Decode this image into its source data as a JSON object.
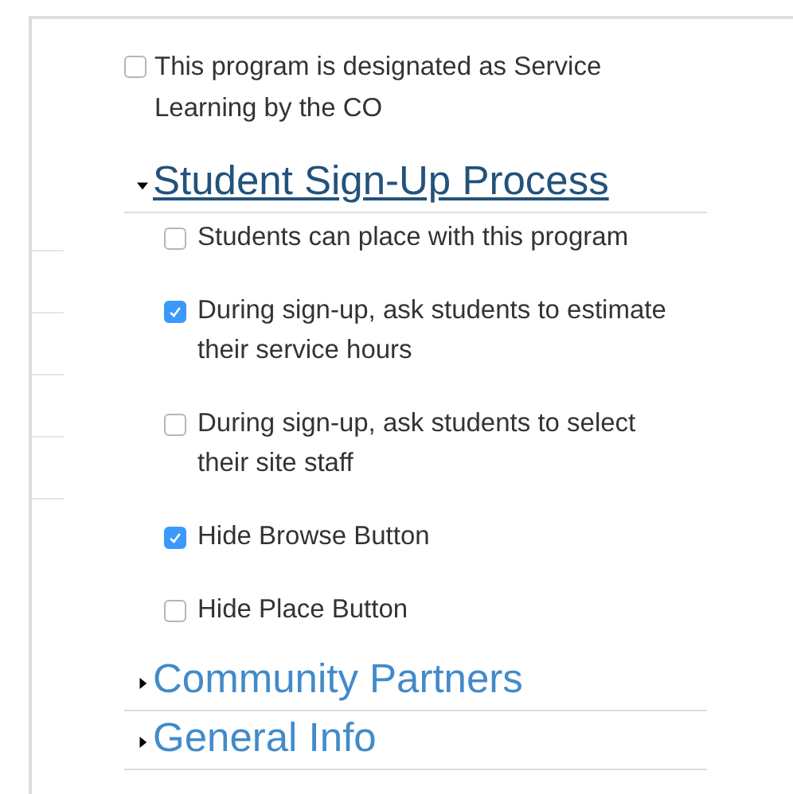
{
  "designation": {
    "label": "This program is designated as Service Learning by the CO",
    "checked": false
  },
  "sections": [
    {
      "title": "Student Sign-Up Process",
      "expanded": true,
      "options": [
        {
          "label": "Students can place with this program",
          "checked": false
        },
        {
          "label": "During sign-up, ask students to estimate their service hours",
          "checked": true
        },
        {
          "label": "During sign-up, ask students to select their site staff",
          "checked": false
        },
        {
          "label": "Hide Browse Button",
          "checked": true
        },
        {
          "label": "Hide Place Button",
          "checked": false
        }
      ]
    },
    {
      "title": "Community Partners",
      "expanded": false
    },
    {
      "title": "General Info",
      "expanded": false
    }
  ]
}
